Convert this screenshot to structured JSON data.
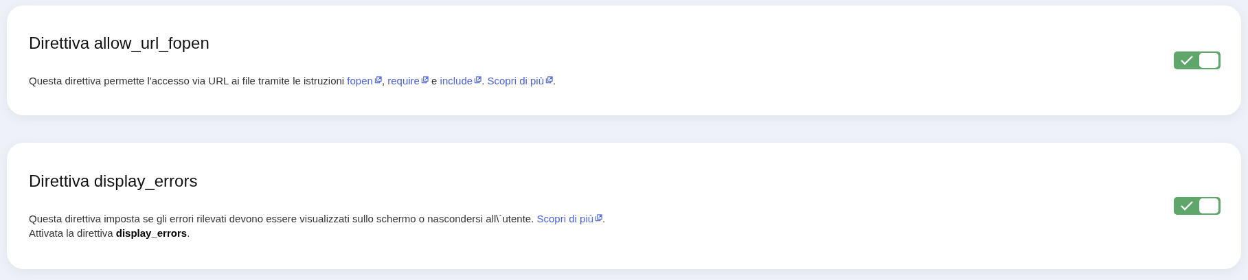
{
  "directives": [
    {
      "title": "Direttiva allow_url_fopen",
      "on": true,
      "lines": [
        [
          {
            "kind": "text",
            "text": "Questa direttiva permette l'accesso via URL ai file tramite le istruzioni "
          },
          {
            "kind": "link",
            "text": "fopen"
          },
          {
            "kind": "text",
            "text": ", "
          },
          {
            "kind": "link",
            "text": "require"
          },
          {
            "kind": "text",
            "text": " e "
          },
          {
            "kind": "link",
            "text": "include"
          },
          {
            "kind": "text",
            "text": ". "
          },
          {
            "kind": "link",
            "text": "Scopri di più"
          },
          {
            "kind": "text",
            "text": "."
          }
        ]
      ]
    },
    {
      "title": "Direttiva display_errors",
      "on": true,
      "lines": [
        [
          {
            "kind": "text",
            "text": "Questa direttiva imposta se gli errori rilevati devono essere visualizzati sullo schermo o nascondersi all\\´utente. "
          },
          {
            "kind": "link",
            "text": "Scopri di più"
          },
          {
            "kind": "text",
            "text": "."
          }
        ],
        [
          {
            "kind": "text",
            "text": "Attivata la direttiva **display_errors**."
          }
        ]
      ]
    }
  ]
}
